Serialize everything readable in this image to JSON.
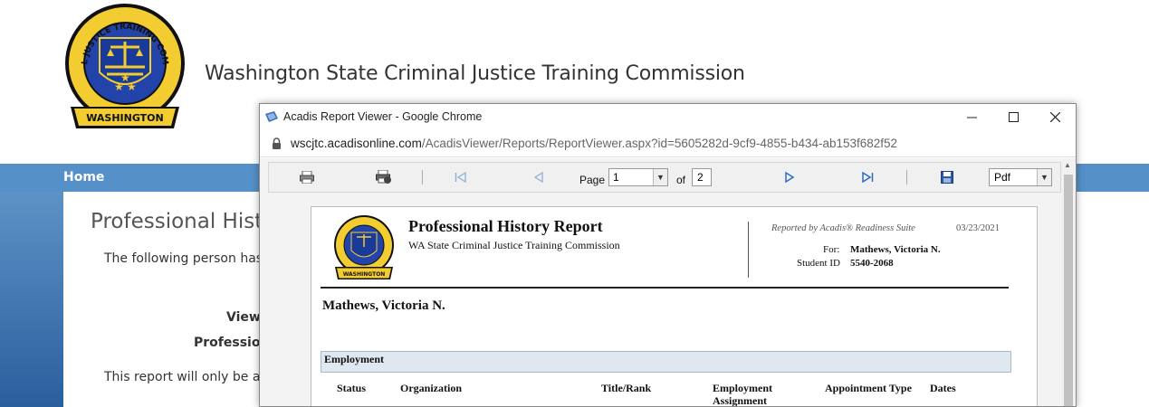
{
  "site": {
    "title": "Washington State Criminal Justice Training Commission",
    "logo_text_top": "CRIMINAL JUSTICE TRAINING COMMISSION",
    "logo_text_bottom": "WASHINGTON",
    "nav": {
      "home": "Home"
    },
    "heading": "Professional Hist",
    "intro": "The following person has sh",
    "view_label": "Viewa",
    "prof_label": "Professiona",
    "availability": "This report will only be avai"
  },
  "popup": {
    "window_title": "Acadis Report Viewer - Google Chrome",
    "url_host": "wscjtc.acadisonline.com",
    "url_path": "/AcadisViewer/Reports/ReportViewer.aspx?id=5605282d-9cf9-4855-b434-ab153f682f52",
    "controls": {
      "minimize": "—",
      "maximize": "☐",
      "close": "✕"
    }
  },
  "toolbar": {
    "page_label": "Page",
    "current_page": "1",
    "of_label": "of",
    "total_pages": "2",
    "format": "Pdf"
  },
  "report": {
    "title": "Professional History Report",
    "organization": "WA State Criminal Justice Training Commission",
    "reported_by": "Reported by Acadis® Readiness Suite",
    "date": "03/23/2021",
    "for_label": "For:",
    "for_value": "Mathews, Victoria N.",
    "student_id_label": "Student ID",
    "student_id_value": "5540-2068",
    "student_name": "Mathews, Victoria N.",
    "section": "Employment",
    "columns": [
      "Status",
      "Organization",
      "Title/Rank",
      "Employment Assignment",
      "Appointment Type",
      "Dates"
    ]
  },
  "colors": {
    "nav_blue": "#5590c8",
    "gradient_dark": "#2a5f9e",
    "section_bg": "#dfe8f0",
    "seal_blue": "#2244aa",
    "seal_gold": "#f2cc30"
  }
}
